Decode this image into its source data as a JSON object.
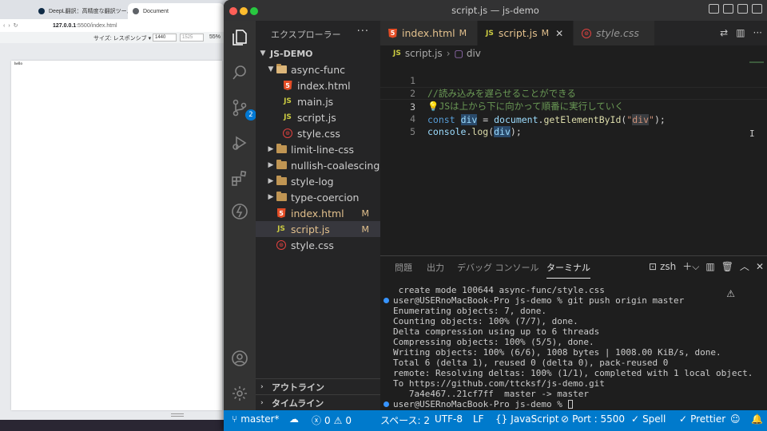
{
  "browser": {
    "tabs": [
      {
        "label": "DeepL翻訳：高精度な翻訳ツール"
      },
      {
        "label": "Document"
      }
    ],
    "address": {
      "host": "127.0.0.1",
      "rest": ":5500/index.html"
    },
    "devtools": {
      "size_label": "サイズ: レスポンシブ ▾",
      "width": "1440",
      "height": "1525",
      "zoom": "55%"
    },
    "page_text": "hello"
  },
  "vscode": {
    "window_title": "script.js — js-demo",
    "activity": {
      "scm_badge": "2"
    },
    "sidebar": {
      "header": "エクスプローラー",
      "more": "···",
      "root": "JS-DEMO",
      "tree": [
        {
          "label": "async-func",
          "kind": "folder-open",
          "indent": 1
        },
        {
          "label": "index.html",
          "kind": "html",
          "indent": 2
        },
        {
          "label": "main.js",
          "kind": "js",
          "indent": 2
        },
        {
          "label": "script.js",
          "kind": "js",
          "indent": 2
        },
        {
          "label": "style.css",
          "kind": "css",
          "indent": 2
        },
        {
          "label": "limit-line-css",
          "kind": "folder",
          "indent": 1
        },
        {
          "label": "nullish-coalescing",
          "kind": "folder",
          "indent": 1
        },
        {
          "label": "style-log",
          "kind": "folder",
          "indent": 1
        },
        {
          "label": "type-coercion",
          "kind": "folder",
          "indent": 1
        },
        {
          "label": "index.html",
          "kind": "html",
          "indent": 1,
          "status": "M"
        },
        {
          "label": "script.js",
          "kind": "js",
          "indent": 1,
          "status": "M",
          "selected": true
        },
        {
          "label": "style.css",
          "kind": "css",
          "indent": 1
        }
      ],
      "outline": "アウトライン",
      "timeline": "タイムライン"
    },
    "tabs": [
      {
        "label": "index.html",
        "kind": "html",
        "status": "M"
      },
      {
        "label": "script.js",
        "kind": "js",
        "status": "M",
        "active": true
      },
      {
        "label": "style.css",
        "kind": "css",
        "italic": true
      }
    ],
    "breadcrumb": {
      "file": "script.js",
      "symbol": "div"
    },
    "editor": {
      "lines": [
        {
          "num": "1"
        },
        {
          "num": "2"
        },
        {
          "num": "3"
        },
        {
          "num": "4"
        },
        {
          "num": "5"
        }
      ],
      "code": {
        "l1": "//読み込みを遅らせることができる",
        "l2_bulb": "💡",
        "l2": "JSは上から下に向かって順番に実行していく",
        "l3_kw": "const",
        "l3_var": "div",
        "l3_eq": " = ",
        "l3_obj": "document",
        "l3_dot": ".",
        "l3_fn": "getElementById",
        "l3_open": "(",
        "l3_str_q1": "\"",
        "l3_str": "div",
        "l3_str_q2": "\"",
        "l3_close": ");",
        "l4_obj": "console",
        "l4_dot": ".",
        "l4_fn": "log",
        "l4_open": "(",
        "l4_var": "div",
        "l4_close": ");"
      }
    },
    "panel": {
      "tabs": [
        "問題",
        "出力",
        "デバッグ コンソール",
        "ターミナル"
      ],
      "shell": "zsh",
      "terminal": [
        " create mode 100644 async-func/style.css",
        "user@USERnoMacBook-Pro js-demo % git push origin master",
        "Enumerating objects: 7, done.",
        "Counting objects: 100% (7/7), done.",
        "Delta compression using up to 6 threads",
        "Compressing objects: 100% (5/5), done.",
        "Writing objects: 100% (6/6), 1008 bytes | 1008.00 KiB/s, done.",
        "Total 6 (delta 1), reused 0 (delta 0), pack-reused 0",
        "remote: Resolving deltas: 100% (1/1), completed with 1 local object.",
        "To https://github.com/ttcksf/js-demo.git",
        "   7a4e467..21cf7ff  master -> master",
        "user@USERnoMacBook-Pro js-demo % "
      ]
    },
    "status": {
      "branch": "master*",
      "errors": "0",
      "warnings": "0",
      "spaces": "スペース: 2",
      "encoding": "UTF-8",
      "eol": "LF",
      "language": "JavaScript",
      "port": "Port : 5500",
      "spell": "Spell",
      "prettier": "Prettier"
    },
    "colors": {
      "accent": "#007acc",
      "modified": "#e2c08d",
      "activity_bg": "#333333",
      "sidebar_bg": "#252526",
      "editor_bg": "#1e1e1e"
    }
  }
}
